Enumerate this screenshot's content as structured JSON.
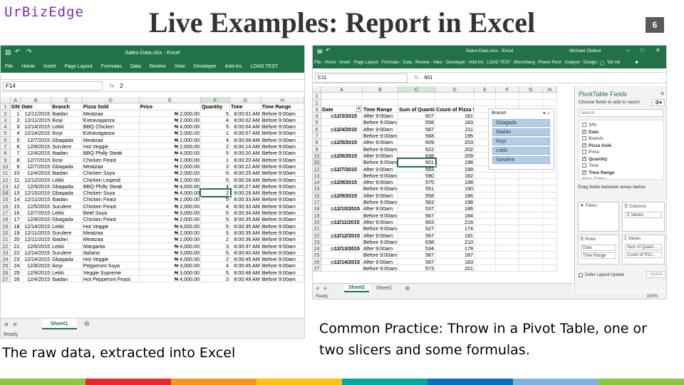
{
  "logo": "UrBizEdge",
  "title": "Live Examples: Report in Excel",
  "page_number": "6",
  "left_window": {
    "file_title": "Sales-Data.xlsx - Excel",
    "ribbon_tabs": [
      "File",
      "Home",
      "Insert",
      "Page Layout",
      "Formulas",
      "Data",
      "Review",
      "View",
      "Developer",
      "Add-ins",
      "LOAD TEST"
    ],
    "name_box": "F14",
    "formula_value": "2",
    "col_letters": [
      "A",
      "B",
      "C",
      "D",
      "E",
      "F",
      "G",
      "H"
    ],
    "headers": [
      "S/N",
      "Date",
      "Branch",
      "Pizza Sold",
      "Price",
      "Quantity",
      "Time",
      "Time Range"
    ],
    "rows": [
      [
        "1",
        "12/11/2015",
        "Ibadan",
        "Meatzaa",
        "₦ 2,000.00",
        "5",
        "8:00:01 AM",
        "Before 9:00am"
      ],
      [
        "2",
        "12/11/2015",
        "Ikoyi",
        "Extravaganza",
        "₦ 2,000.00",
        "4",
        "8:00:02 AM",
        "Before 9:00am"
      ],
      [
        "3",
        "12/14/2015",
        "Lekki",
        "BBQ Chicken",
        "₦ 4,000.00",
        "5",
        "8:00:04 AM",
        "Before 9:00am"
      ],
      [
        "4",
        "12/14/2015",
        "Ikoyi",
        "Extravaganza",
        "₦ 2,000.00",
        "1",
        "8:00:07 AM",
        "Before 9:00am"
      ],
      [
        "5",
        "12/7/2015",
        "Gbagada",
        "Meatzaa",
        "₦ 2,000.00",
        "4",
        "8:00:08 AM",
        "Before 9:00am"
      ],
      [
        "6",
        "12/8/2015",
        "Surulere",
        "Hot Veggie",
        "₦ 2,000.00",
        "2",
        "8:00:14 AM",
        "Before 9:00am"
      ],
      [
        "7",
        "12/4/2015",
        "Ibadan",
        "BBQ Philly Steak",
        "₦ 4,000.00",
        "5",
        "8:00:20 AM",
        "Before 9:00am"
      ],
      [
        "8",
        "12/7/2015",
        "Ikoyi",
        "Chicken Feast",
        "₦ 2,000.00",
        "1",
        "8:00:20 AM",
        "Before 9:00am"
      ],
      [
        "9",
        "12/7/2015",
        "Gbagada",
        "Meatzaa",
        "₦ 2,000.00",
        "3",
        "8:00:22 AM",
        "Before 9:00am"
      ],
      [
        "10",
        "12/4/2015",
        "Ibadan",
        "Chicken Suya",
        "₦ 2,000.00",
        "5",
        "8:00:25 AM",
        "Before 9:00am"
      ],
      [
        "11",
        "12/12/2015",
        "Lekki",
        "Chicken Legend",
        "₦ 2,000.00",
        "5",
        "8:00:26 AM",
        "Before 9:00am"
      ],
      [
        "12",
        "12/9/2015",
        "Gbagada",
        "BBQ Philly Steak",
        "₦ 4,000.00",
        "4",
        "8:00:27 AM",
        "Before 9:00am"
      ],
      [
        "13",
        "12/15/2015",
        "Gbagada",
        "Chicken Suya",
        "₦ 4,000.00",
        "2",
        "8:00:29 AM",
        "Before 9:00am"
      ],
      [
        "14",
        "12/11/2015",
        "Ibadan",
        "Chicken Feast",
        "₦ 2,000.00",
        "5",
        "8:00:33 AM",
        "Before 9:00am"
      ],
      [
        "15",
        "12/5/2015",
        "Surulere",
        "Chicken Feast",
        "₦ 2,000.00",
        "4",
        "8:00:33 AM",
        "Before 9:00am"
      ],
      [
        "16",
        "12/7/2015",
        "Lekki",
        "Beef Suya",
        "₦ 3,000.00",
        "5",
        "8:00:34 AM",
        "Before 9:00am"
      ],
      [
        "17",
        "12/8/2015",
        "Gbagada",
        "Chicken Feast",
        "₦ 2,000.00",
        "5",
        "8:00:35 AM",
        "Before 9:00am"
      ],
      [
        "18",
        "12/14/2015",
        "Lekki",
        "Hot Veggie",
        "₦ 4,000.00",
        "5",
        "8:00:35 AM",
        "Before 9:00am"
      ],
      [
        "19",
        "12/11/2015",
        "Surulere",
        "Meatzaa",
        "₦ 2,000.00",
        "5",
        "8:00:35 AM",
        "Before 9:00am"
      ],
      [
        "20",
        "12/11/2015",
        "Ibadan",
        "Meatzaa",
        "₦ 2,000.00",
        "2",
        "8:00:36 AM",
        "Before 9:00am"
      ],
      [
        "21",
        "12/6/2015",
        "Lekki",
        "Margarita",
        "₦ 4,000.00",
        "3",
        "8:00:37 AM",
        "Before 9:00am"
      ],
      [
        "22",
        "12/14/2015",
        "Surulere",
        "Italiano",
        "₦ 3,000.00",
        "5",
        "8:00:40 AM",
        "Before 9:00am"
      ],
      [
        "23",
        "12/14/2015",
        "Gbagada",
        "Hot Veggie",
        "₦ 4,000.00",
        "2",
        "8:00:45 AM",
        "Before 9:00am"
      ],
      [
        "24",
        "12/8/2015",
        "Ikoyi",
        "Pepperoni Suya",
        "₦ 3,000.00",
        "4",
        "8:00:45 AM",
        "Before 9:00am"
      ],
      [
        "25",
        "12/9/2015",
        "Lekki",
        "Veggie Supreme",
        "₦ 3,000.00",
        "5",
        "8:00:48 AM",
        "Before 9:00am"
      ],
      [
        "26",
        "12/4/2015",
        "Ibadan",
        "Hot Pepperoni Feast",
        "₦ 4,000.00",
        "3",
        "8:00:49 AM",
        "Before 9:00am"
      ]
    ],
    "sheet_tab": "Sheet1",
    "status": "Ready"
  },
  "right_window": {
    "file_title": "Sales-Data.xlsx - Excel",
    "user": "Michael Olafusi",
    "ribbon_tabs": [
      "File",
      "Home",
      "Insert",
      "Page Layout",
      "Formulas",
      "Data",
      "Review",
      "View",
      "Developer",
      "Add-ins",
      "LOAD TEST",
      "Bloomberg",
      "Power Pivot",
      "Analyze",
      "Design"
    ],
    "tell_me": "Tell me",
    "name_box": "C11",
    "formula_value": "601",
    "col_letters": [
      "A",
      "B",
      "C",
      "D",
      "E",
      "F",
      "G",
      "H"
    ],
    "pivot_headers": [
      "Date",
      "Time Range",
      "Sum of Quantity",
      "Count of Pizza Sold"
    ],
    "pivot_rows": [
      [
        "12/3/2015",
        "After 9:00am",
        "607",
        "181"
      ],
      [
        "",
        "Before 9:00am",
        "558",
        "183"
      ],
      [
        "12/4/2015",
        "After 9:00am",
        "587",
        "211"
      ],
      [
        "",
        "Before 9:00am",
        "568",
        "195"
      ],
      [
        "12/5/2015",
        "After 9:00am",
        "609",
        "203"
      ],
      [
        "",
        "Before 9:00am",
        "622",
        "202"
      ],
      [
        "12/6/2015",
        "After 9:00am",
        "638",
        "209"
      ],
      [
        "",
        "Before 9:00am",
        "601",
        "198"
      ],
      [
        "12/7/2015",
        "After 9:00am",
        "593",
        "199"
      ],
      [
        "",
        "Before 9:00am",
        "590",
        "182"
      ],
      [
        "12/8/2015",
        "After 9:00am",
        "575",
        "198"
      ],
      [
        "",
        "Before 9:00am",
        "551",
        "190"
      ],
      [
        "12/9/2015",
        "After 9:00am",
        "558",
        "186"
      ],
      [
        "",
        "Before 9:00am",
        "563",
        "198"
      ],
      [
        "12/10/2015",
        "After 9:00am",
        "537",
        "186"
      ],
      [
        "",
        "Before 9:00am",
        "567",
        "184"
      ],
      [
        "12/11/2015",
        "After 9:00am",
        "663",
        "216"
      ],
      [
        "",
        "Before 9:00am",
        "527",
        "174"
      ],
      [
        "12/12/2015",
        "After 9:00am",
        "567",
        "191"
      ],
      [
        "",
        "Before 9:00am",
        "638",
        "210"
      ],
      [
        "12/13/2015",
        "After 9:00am",
        "534",
        "178"
      ],
      [
        "",
        "Before 9:00am",
        "587",
        "187"
      ],
      [
        "12/14/2015",
        "After 9:00am",
        "567",
        "183"
      ],
      [
        "",
        "Before 9:00am",
        "573",
        "201"
      ]
    ],
    "slicer": {
      "title": "Branch",
      "items": [
        "Gbagada",
        "Ibadan",
        "Ikoyi",
        "Lekki",
        "Surulere"
      ]
    },
    "pivot_pane": {
      "title": "PivotTable Fields",
      "subtitle": "Choose fields to add to report:",
      "search_placeholder": "Search",
      "fields": [
        {
          "name": "S/N",
          "checked": false
        },
        {
          "name": "Date",
          "checked": true
        },
        {
          "name": "Branch",
          "checked": false
        },
        {
          "name": "Pizza Sold",
          "checked": true
        },
        {
          "name": "Price",
          "checked": false
        },
        {
          "name": "Quantity",
          "checked": true
        },
        {
          "name": "Time",
          "checked": false
        },
        {
          "name": "Time Range",
          "checked": true
        }
      ],
      "more_tables": "More Tables...",
      "drag_label": "Drag fields between areas below:",
      "filters": "Filters",
      "columns": "Columns",
      "columns_chip": "Σ Values",
      "rows": "Rows",
      "rows_chips": [
        "Date",
        "Time Range"
      ],
      "values": "Σ Values",
      "values_chips": [
        "Sum of Quant...",
        "Count of Pizz..."
      ],
      "defer": "Defer Layout Update",
      "update": "Update"
    },
    "sheet_tabs": [
      "Sheet2",
      "Sheet1"
    ],
    "status": "Ready",
    "zoom": "100%"
  },
  "caption_left": "The raw data, extracted into Excel",
  "caption_right": "Common Practice: Throw in a Pivot Table, one or two slicers and some formulas.",
  "colors": {
    "excel_green": "#217346",
    "bar": [
      "#8dc63f",
      "#e8262d",
      "#f7941d",
      "#ffc20e",
      "#00a99d",
      "#0072bc",
      "#7fb1dd",
      "#8dc63f"
    ]
  }
}
